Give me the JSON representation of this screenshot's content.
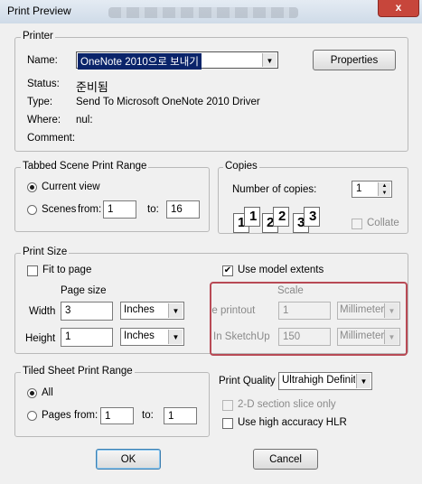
{
  "window": {
    "title": "Print Preview",
    "blurred_title": "",
    "close_glyph": "x"
  },
  "printer": {
    "legend": "Printer",
    "name_label": "Name:",
    "name_value": "OneNote 2010으로 보내기",
    "properties_label": "Properties",
    "status_label": "Status:",
    "status_value": "준비됨",
    "type_label": "Type:",
    "type_value": "Send To Microsoft OneNote 2010 Driver",
    "where_label": "Where:",
    "where_value": "nul:",
    "comment_label": "Comment:"
  },
  "tabbed_range": {
    "legend": "Tabbed Scene Print Range",
    "current_view_label": "Current view",
    "scenes_label": "Scenes",
    "from_label": "from:",
    "from_value": "1",
    "to_label": "to:",
    "to_value": "16",
    "selected": "current_view"
  },
  "copies": {
    "legend": "Copies",
    "number_label": "Number of copies:",
    "number_value": "1",
    "collate_label": "Collate",
    "collate_checked": false,
    "collate_enabled": false,
    "page_numbers": [
      "1",
      "1",
      "2",
      "2",
      "3",
      "3"
    ]
  },
  "print_size": {
    "legend": "Print Size",
    "fit_to_page_label": "Fit to page",
    "fit_to_page_checked": false,
    "use_model_extents_label": "Use model extents",
    "use_model_extents_checked": true,
    "page_size_label": "Page size",
    "width_label": "Width",
    "width_value": "3",
    "width_unit": "Inches",
    "height_label": "Height",
    "height_value": "1",
    "height_unit": "Inches",
    "scale_label": "Scale",
    "in_printout_label": "In the printout",
    "in_printout_value": "1",
    "in_printout_unit": "Millimeters",
    "in_sketchup_label": "In SketchUp",
    "in_sketchup_value": "150",
    "in_sketchup_unit": "Millimeters"
  },
  "tiled_range": {
    "legend": "Tiled Sheet Print Range",
    "all_label": "All",
    "pages_label": "Pages",
    "from_label": "from:",
    "from_value": "1",
    "to_label": "to:",
    "to_value": "1",
    "selected": "all"
  },
  "quality": {
    "label": "Print Quality",
    "value": "Ultrahigh Definition",
    "section_slice_label": "2-D section slice only",
    "section_slice_checked": false,
    "section_slice_enabled": false,
    "hlr_label": "Use high accuracy HLR",
    "hlr_checked": false
  },
  "buttons": {
    "ok": "OK",
    "cancel": "Cancel"
  },
  "colors": {
    "highlight_box": "#b84a55",
    "selection": "#0a246a"
  }
}
